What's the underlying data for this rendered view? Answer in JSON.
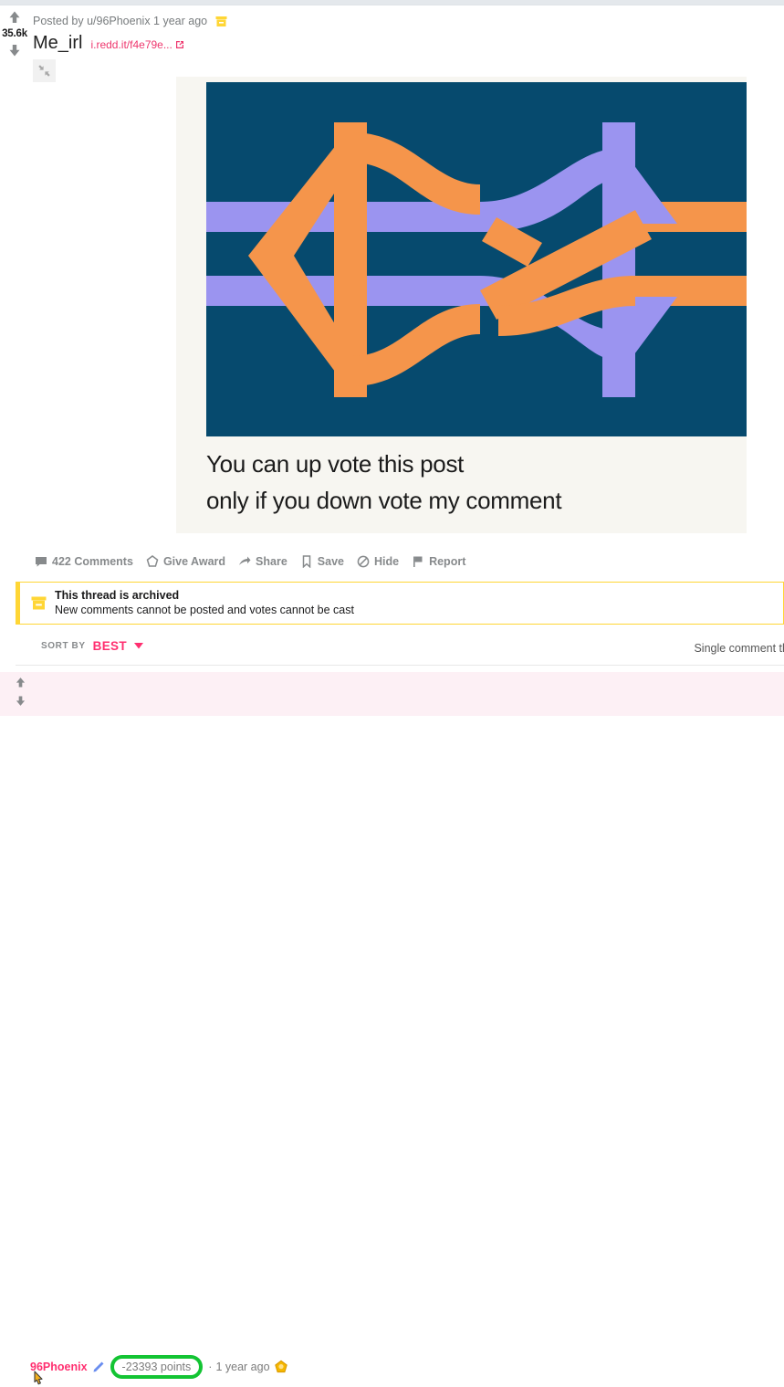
{
  "post": {
    "vote": {
      "score": "35.6k",
      "upvote_icon": "upvote-arrow-icon",
      "downvote_icon": "downvote-arrow-icon"
    },
    "byline": "Posted by u/96Phoenix 1 year ago",
    "archive_icon": "archived-box-icon",
    "title": "Me_irl",
    "outlink_text": "i.redd.it/f4e79e...",
    "outlink_icon": "external-link-icon",
    "expand_icon": "collapse-arrows-icon",
    "media": {
      "background_color": "#f7f6f1",
      "art_background": "#064a6e",
      "arrow_orange": "#f5954b",
      "arrow_purple": "#9b94f0",
      "caption_line_1": "You can up vote this post",
      "caption_line_2": "only if you down vote my comment"
    },
    "actions": [
      {
        "label": "422 Comments",
        "icon": "comment-bubble-icon"
      },
      {
        "label": "Give Award",
        "icon": "award-icon"
      },
      {
        "label": "Share",
        "icon": "share-arrow-icon"
      },
      {
        "label": "Save",
        "icon": "bookmark-icon"
      },
      {
        "label": "Hide",
        "icon": "hide-circle-icon"
      },
      {
        "label": "Report",
        "icon": "flag-icon"
      }
    ]
  },
  "archived_banner": {
    "icon": "archived-box-icon",
    "title": "This thread is archived",
    "subtitle": "New comments cannot be posted and votes cannot be cast",
    "accent_color": "#ffd635"
  },
  "sort_bar": {
    "label": "SORT BY",
    "value": "BEST",
    "caret_icon": "chevron-down-icon",
    "single_comment_link": "Single comment thread"
  },
  "comment": {
    "background_color": "#fdf0f5",
    "upvote_icon": "upvote-arrow-icon",
    "downvote_icon": "downvote-arrow-icon",
    "author": "96Phoenix",
    "op_icon": "op-marker-icon",
    "points": "-23393 points",
    "points_highlight_color": "#13c433",
    "separator": "·",
    "timestamp": "1 year ago",
    "award_icon": "gold-award-icon",
    "cursor_icon": "hand-cursor-icon"
  }
}
